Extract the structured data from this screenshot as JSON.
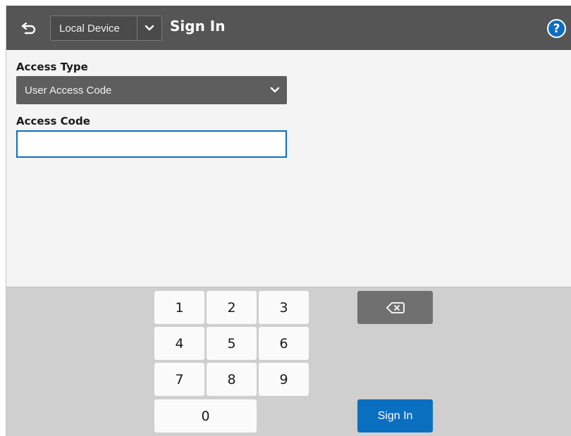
{
  "header": {
    "back_icon": "back-arrow-icon",
    "device_select_value": "Local Device",
    "device_chevron_icon": "chevron-down-icon",
    "title": "Sign In",
    "help_label": "?",
    "help_icon": "help-icon"
  },
  "form": {
    "access_type_label": "Access Type",
    "access_type_value": "User Access Code",
    "access_type_chevron_icon": "chevron-down-icon",
    "access_code_label": "Access Code",
    "access_code_value": ""
  },
  "keypad": {
    "keys": [
      "1",
      "2",
      "3",
      "4",
      "5",
      "6",
      "7",
      "8",
      "9",
      "0"
    ],
    "backspace_icon": "backspace-icon",
    "sign_in_label": "Sign In"
  },
  "colors": {
    "header_bg": "#555555",
    "accent": "#0b6fc0",
    "select_bg": "#5e5e5e",
    "keypad_bg": "#cfcfcf"
  }
}
